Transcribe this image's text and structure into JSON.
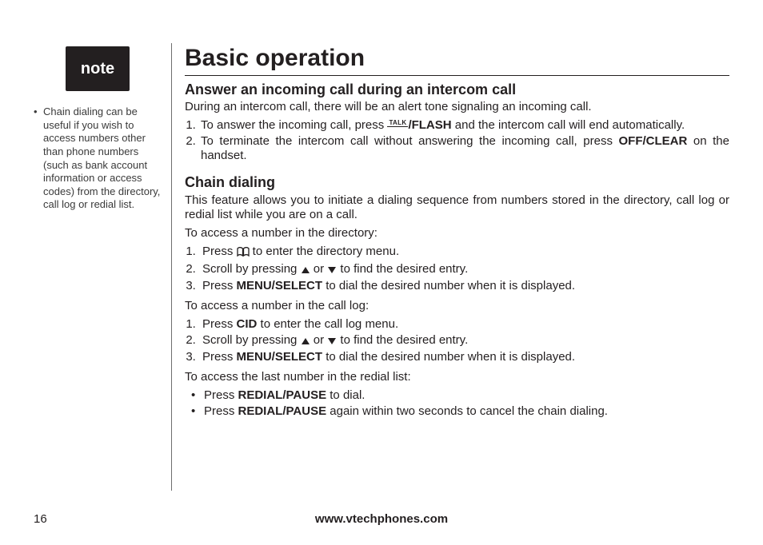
{
  "sidebar": {
    "noteBadge": "note",
    "noteItems": [
      "Chain dialing can be useful if you wish to access numbers other than phone numbers (such as bank account information or access codes) from the directory, call log or redial list."
    ]
  },
  "main": {
    "title": "Basic operation",
    "section1": {
      "heading": "Answer an incoming call during an intercom call",
      "intro": "During an intercom call, there will be an alert tone signaling an incoming call.",
      "step1_a": "To answer the incoming call, press ",
      "step1_bold": "/FLASH",
      "step1_b": " and the intercom call will end automatically.",
      "step2_a": "To terminate the intercom call without answering the incoming call, press ",
      "step2_bold": "OFF/CLEAR",
      "step2_b": " on the",
      "step2_c": "handset."
    },
    "section2": {
      "heading": "Chain dialing",
      "intro": "This feature allows you to initiate a dialing sequence from numbers stored in the directory, call log or redial list while you are on a call.",
      "dirLabel": "To access a number in the directory:",
      "dir1_a": "Press ",
      "dir1_b": " to enter the directory menu.",
      "dir2_a": "Scroll by pressing ",
      "dir2_or": " or ",
      "dir2_b": " to find the desired entry.",
      "dir3_a": "Press ",
      "dir3_bold": "MENU/SELECT",
      "dir3_b": " to dial the desired number when it is displayed.",
      "callLabel": "To access a number in the call log:",
      "call1_a": "Press ",
      "call1_bold": "CID",
      "call1_b": " to enter the call log menu.",
      "call2_a": "Scroll by pressing ",
      "call2_or": " or ",
      "call2_b": " to find the desired entry.",
      "call3_a": "Press ",
      "call3_bold": "MENU/SELECT",
      "call3_b": " to dial the desired number when it is displayed.",
      "redialLabel": "To access the last number in the redial list:",
      "redial1_a": "Press ",
      "redial1_bold": "REDIAL/PAUSE",
      "redial1_b": " to dial.",
      "redial2_a": " Press ",
      "redial2_bold": "REDIAL/PAUSE",
      "redial2_b": " again within two seconds to cancel the chain dialing."
    }
  },
  "footer": {
    "pageNumber": "16",
    "url": "www.vtechphones.com"
  },
  "icons": {
    "talkLabel": "TALK"
  }
}
